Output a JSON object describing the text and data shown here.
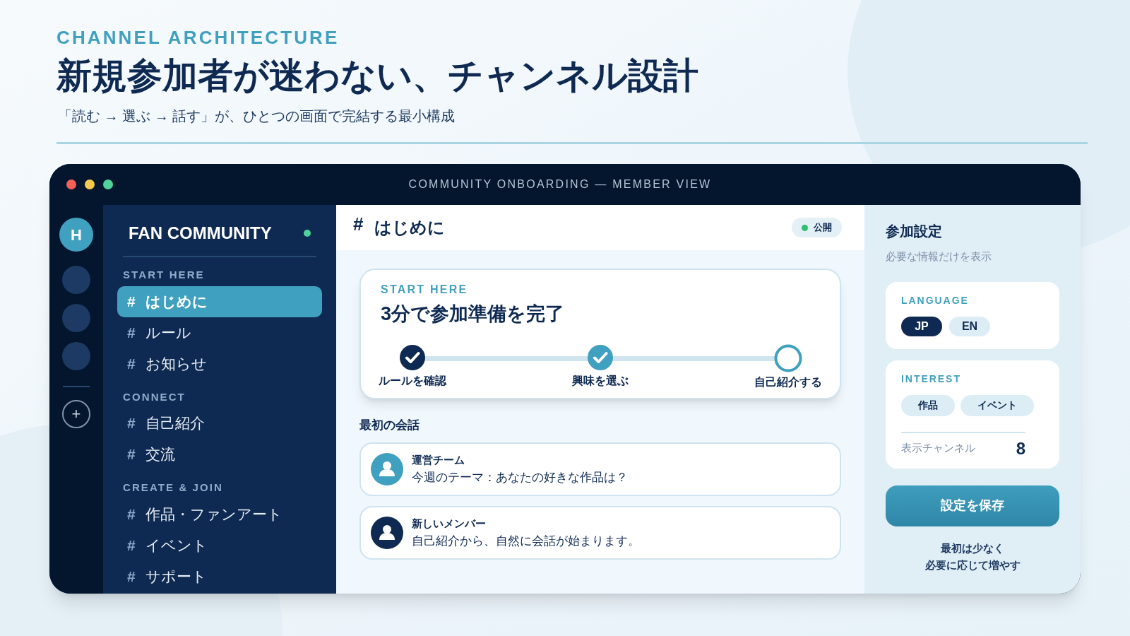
{
  "eyebrow": "CHANNEL ARCHITECTURE",
  "headline": "新規参加者が迷わない、チャンネル設計",
  "subtitle": "「読む → 選ぶ → 話す」が、ひとつの画面で完結する最小構成",
  "window": {
    "title": "COMMUNITY ONBOARDING — MEMBER VIEW"
  },
  "rail": {
    "servers": [
      {
        "label": "H",
        "selected": true
      },
      {
        "selected": false
      },
      {
        "selected": false
      },
      {
        "selected": false
      }
    ],
    "add": "+"
  },
  "sidebar": {
    "title": "FAN COMMUNITY",
    "online": true,
    "sections": [
      {
        "heading": "START HERE",
        "items": [
          {
            "hash": "#",
            "label": "はじめに",
            "selected": true
          },
          {
            "hash": "#",
            "label": "ルール",
            "selected": false
          },
          {
            "hash": "#",
            "label": "お知らせ",
            "selected": false
          }
        ]
      },
      {
        "heading": "CONNECT",
        "items": [
          {
            "hash": "#",
            "label": "自己紹介",
            "selected": false
          },
          {
            "hash": "#",
            "label": "交流",
            "selected": false
          }
        ]
      },
      {
        "heading": "CREATE & JOIN",
        "items": [
          {
            "hash": "#",
            "label": "作品・ファンアート",
            "selected": false
          },
          {
            "hash": "#",
            "label": "イベント",
            "selected": false
          },
          {
            "hash": "#",
            "label": "サポート",
            "selected": false
          }
        ]
      }
    ]
  },
  "channel": {
    "hash": "#",
    "name": "はじめに",
    "badge": "公開"
  },
  "start_card": {
    "eyebrow": "START HERE",
    "title": "3分で参加準備を完了",
    "steps": [
      {
        "label": "ルールを確認",
        "checked": true,
        "color": "#0f2a52"
      },
      {
        "label": "興味を選ぶ",
        "checked": true,
        "color": "#40a0bf"
      },
      {
        "label": "自己紹介する",
        "checked": false,
        "color": "#40a0bf"
      }
    ]
  },
  "conversation": {
    "heading": "最初の会話",
    "messages": [
      {
        "author": "運営チーム",
        "text": "今週のテーマ：あなたの好きな作品は？",
        "color": "#40a0bf"
      },
      {
        "author": "新しいメンバー",
        "text": "自己紹介から、自然に会話が始まります。",
        "color": "#0f2a52"
      }
    ]
  },
  "settings": {
    "title": "参加設定",
    "subtitle": "必要な情報だけを表示",
    "language": {
      "heading": "LANGUAGE",
      "options": [
        {
          "label": "JP",
          "selected": true
        },
        {
          "label": "EN",
          "selected": false
        }
      ]
    },
    "interest": {
      "heading": "INTEREST",
      "chips": [
        "作品",
        "イベント"
      ],
      "count_label": "表示チャンネル",
      "count": "8"
    },
    "save": "設定を保存",
    "note": [
      "最初は少なく",
      "必要に応じて増やす"
    ]
  }
}
